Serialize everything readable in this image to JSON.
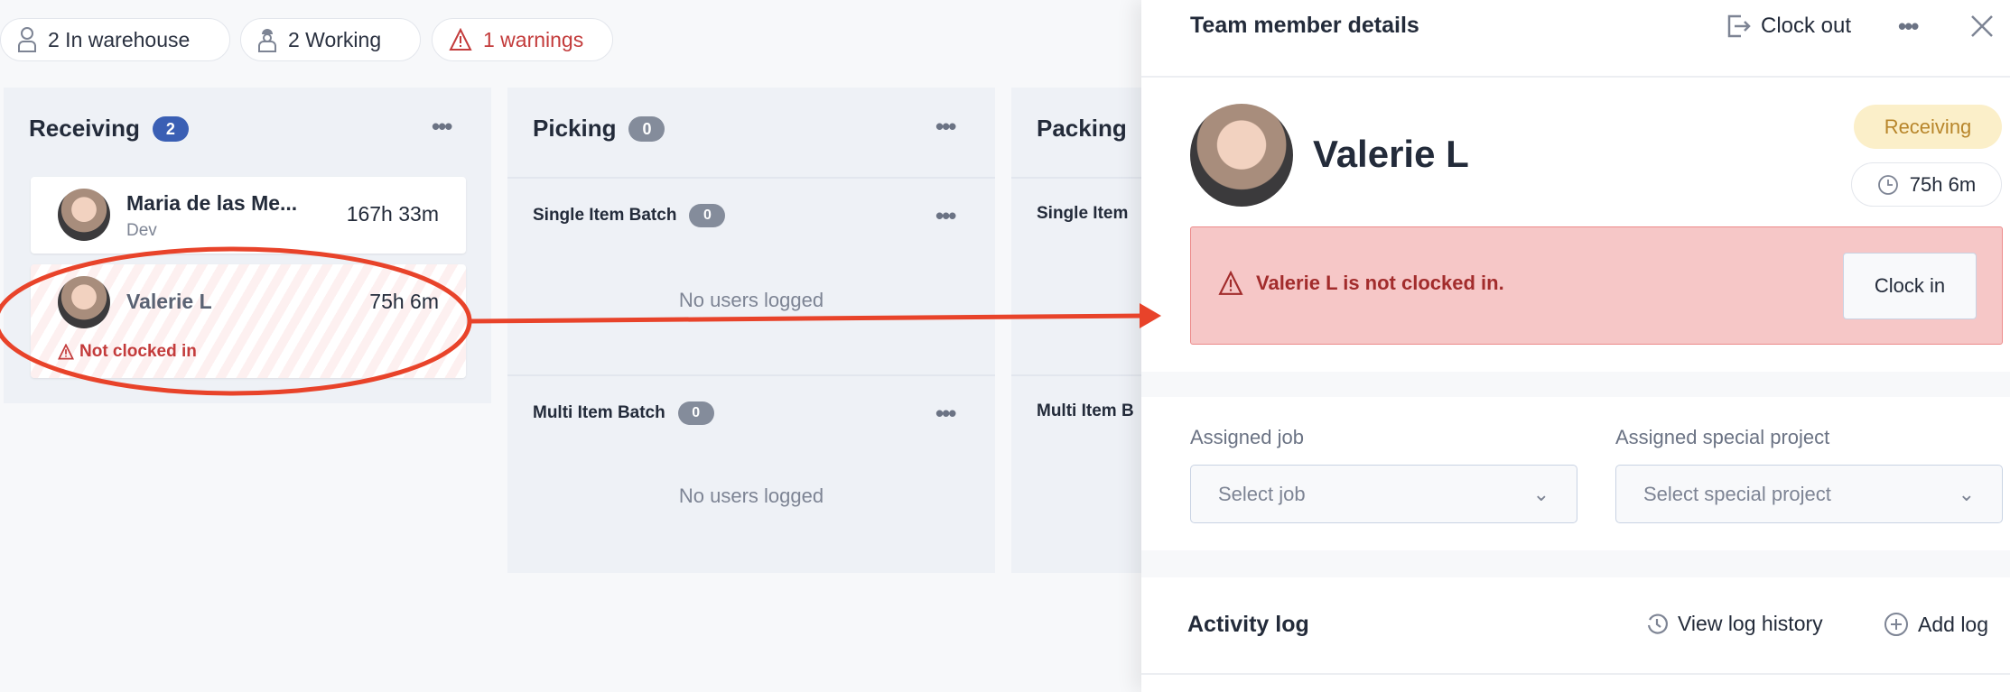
{
  "summary": {
    "in_warehouse": "2 In warehouse",
    "working": "2 Working",
    "warnings": "1 warnings"
  },
  "colors": {
    "accent": "#3a5fb4",
    "warning": "#c33b3b",
    "annotation": "#e8432a",
    "alert_bg": "#f6c7c7",
    "status_bg": "#fbefc9"
  },
  "columns": [
    {
      "title": "Receiving",
      "count": "2",
      "members": [
        {
          "name": "Maria de las Me...",
          "role": "Dev",
          "time": "167h 33m"
        },
        {
          "name": "Valerie L",
          "time": "75h 6m",
          "warning": "Not clocked in"
        }
      ]
    },
    {
      "title": "Picking",
      "count": "0",
      "groups": [
        {
          "title": "Single Item Batch",
          "count": "0",
          "empty": "No users logged"
        },
        {
          "title": "Multi Item Batch",
          "count": "0",
          "empty": "No users logged"
        }
      ]
    },
    {
      "title": "Packing",
      "groups": [
        {
          "title": "Single Item"
        },
        {
          "title": "Multi Item B"
        }
      ]
    }
  ],
  "panel": {
    "title": "Team member details",
    "clock_out": "Clock out",
    "name": "Valerie L",
    "status": "Receiving",
    "time": "75h 6m",
    "alert": "Valerie L is not clocked in.",
    "clock_in": "Clock in",
    "job_label": "Assigned job",
    "job_placeholder": "Select job",
    "project_label": "Assigned special project",
    "project_placeholder": "Select special project",
    "activity_title": "Activity log",
    "view_history": "View log history",
    "add_log": "Add log"
  }
}
